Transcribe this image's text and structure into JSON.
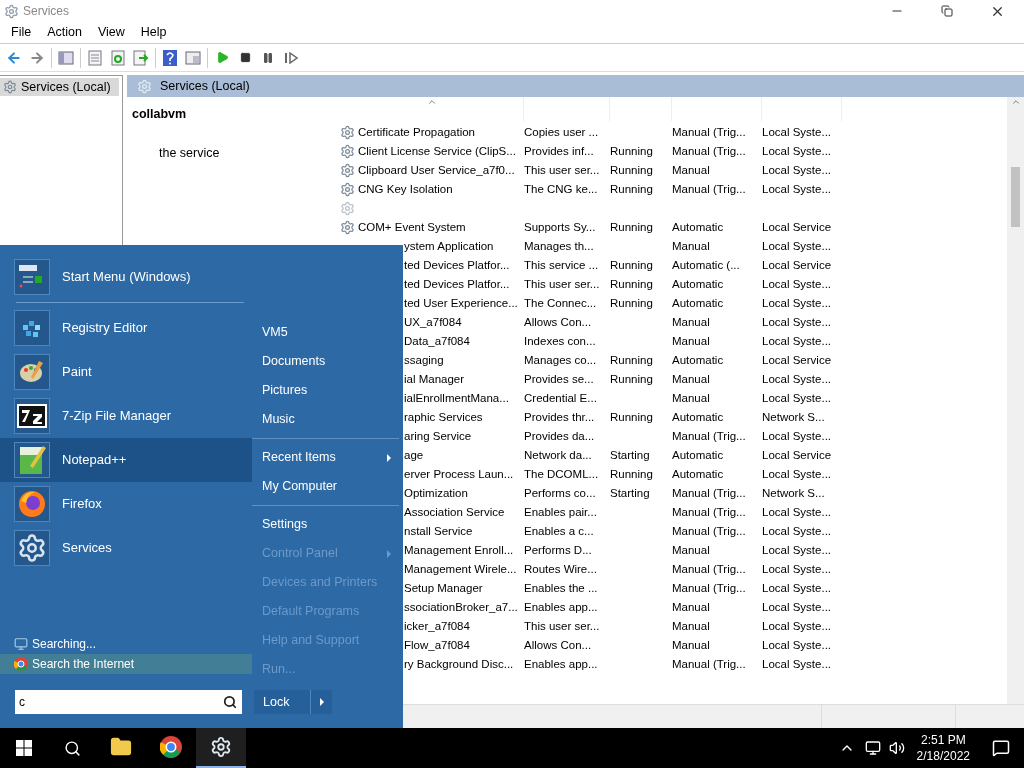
{
  "window": {
    "title": "Services"
  },
  "menu": [
    "File",
    "Action",
    "View",
    "Help"
  ],
  "tree": {
    "label": "Services (Local)",
    "selected": true
  },
  "pane_header": "Services (Local)",
  "description": {
    "title": "collabvm",
    "text": "the service"
  },
  "services": [
    {
      "name": "Certificate Propagation",
      "description": "Copies user ...",
      "startup": "Manual (Trig...",
      "logon": "Local Syste...",
      "covered": false
    },
    {
      "name": "Client License Service (ClipS...",
      "description": "Provides inf...",
      "status": "Running",
      "startup": "Manual (Trig...",
      "logon": "Local Syste...",
      "covered": false
    },
    {
      "name": "Clipboard User Service_a7f0...",
      "description": "This user ser...",
      "status": "Running",
      "startup": "Manual",
      "logon": "Local Syste...",
      "covered": false
    },
    {
      "name": "CNG Key Isolation",
      "description": "The CNG ke...",
      "status": "Running",
      "startup": "Manual (Trig...",
      "logon": "Local Syste...",
      "covered": false
    },
    {
      "covered": false
    },
    {
      "name": "COM+ Event System",
      "description": "Supports Sy...",
      "status": "Running",
      "startup": "Automatic",
      "logon": "Local Service",
      "covered": false
    },
    {
      "name": "ystem Application",
      "description": "Manages th...",
      "startup": "Manual",
      "logon": "Local Syste...",
      "covered": true
    },
    {
      "name": "ted Devices Platfor...",
      "description": "This service ...",
      "status": "Running",
      "startup": "Automatic (...",
      "logon": "Local Service",
      "covered": true
    },
    {
      "name": "ted Devices Platfor...",
      "description": "This user ser...",
      "status": "Running",
      "startup": "Automatic",
      "logon": "Local Syste...",
      "covered": true
    },
    {
      "name": "ted User Experience...",
      "description": "The Connec...",
      "status": "Running",
      "startup": "Automatic",
      "logon": "Local Syste...",
      "covered": true
    },
    {
      "name": "UX_a7f084",
      "description": "Allows Con...",
      "startup": "Manual",
      "logon": "Local Syste...",
      "covered": true
    },
    {
      "name": "Data_a7f084",
      "description": "Indexes con...",
      "startup": "Manual",
      "logon": "Local Syste...",
      "covered": true
    },
    {
      "name": "ssaging",
      "description": "Manages co...",
      "status": "Running",
      "startup": "Automatic",
      "logon": "Local Service",
      "covered": true
    },
    {
      "name": "ial Manager",
      "description": "Provides se...",
      "status": "Running",
      "startup": "Manual",
      "logon": "Local Syste...",
      "covered": true
    },
    {
      "name": "ialEnrollmentMana...",
      "description": "Credential E...",
      "startup": "Manual",
      "logon": "Local Syste...",
      "covered": true
    },
    {
      "name": "raphic Services",
      "description": "Provides thr...",
      "status": "Running",
      "startup": "Automatic",
      "logon": "Network S...",
      "covered": true
    },
    {
      "name": "aring Service",
      "description": "Provides da...",
      "startup": "Manual (Trig...",
      "logon": "Local Syste...",
      "covered": true
    },
    {
      "name": "age",
      "description": "Network da...",
      "status": "Starting",
      "startup": "Automatic",
      "logon": "Local Service",
      "covered": true
    },
    {
      "name": "erver Process Laun...",
      "description": "The DCOML...",
      "status": "Running",
      "startup": "Automatic",
      "logon": "Local Syste...",
      "covered": true
    },
    {
      "name": "Optimization",
      "description": "Performs co...",
      "status": "Starting",
      "startup": "Manual (Trig...",
      "logon": "Network S...",
      "covered": true
    },
    {
      "name": "Association Service",
      "description": "Enables pair...",
      "startup": "Manual (Trig...",
      "logon": "Local Syste...",
      "covered": true
    },
    {
      "name": "nstall Service",
      "description": "Enables a c...",
      "startup": "Manual (Trig...",
      "logon": "Local Syste...",
      "covered": true
    },
    {
      "name": "Management Enroll...",
      "description": "Performs D...",
      "startup": "Manual",
      "logon": "Local Syste...",
      "covered": true
    },
    {
      "name": "Management Wirele...",
      "description": "Routes Wire...",
      "startup": "Manual (Trig...",
      "logon": "Local Syste...",
      "covered": true
    },
    {
      "name": "Setup Manager",
      "description": "Enables the ...",
      "startup": "Manual (Trig...",
      "logon": "Local Syste...",
      "covered": true
    },
    {
      "name": "ssociationBroker_a7...",
      "description": "Enables app...",
      "startup": "Manual",
      "logon": "Local Syste...",
      "covered": true
    },
    {
      "name": "icker_a7f084",
      "description": "This user ser...",
      "startup": "Manual",
      "logon": "Local Syste...",
      "covered": true
    },
    {
      "name": "Flow_a7f084",
      "description": "Allows Con...",
      "startup": "Manual",
      "logon": "Local Syste...",
      "covered": true
    },
    {
      "name": "ry Background Disc...",
      "description": "Enables app...",
      "startup": "Manual (Trig...",
      "logon": "Local Syste...",
      "covered": true
    }
  ],
  "start_menu": {
    "pinned": [
      {
        "label": "Start Menu (Windows)",
        "selected": false
      }
    ],
    "programs": [
      {
        "label": "Registry Editor",
        "selected": false
      },
      {
        "label": "Paint",
        "selected": false
      },
      {
        "label": "7-Zip File Manager",
        "selected": false
      },
      {
        "label": "Notepad++",
        "selected": true
      },
      {
        "label": "Firefox",
        "selected": false
      },
      {
        "label": "Services",
        "selected": false
      }
    ],
    "search_results": [
      {
        "label": "Searching...",
        "selected": false
      },
      {
        "label": "Search the Internet",
        "selected": true
      }
    ],
    "search": {
      "value": "c"
    },
    "places": [
      [
        {
          "label": "VM5",
          "submenu": false,
          "disabled": false
        },
        {
          "label": "Documents",
          "submenu": false,
          "disabled": false
        },
        {
          "label": "Pictures",
          "submenu": false,
          "disabled": false
        },
        {
          "label": "Music",
          "submenu": false,
          "disabled": false
        }
      ],
      [
        {
          "label": "Recent Items",
          "submenu": true,
          "disabled": false
        },
        {
          "label": "My Computer",
          "submenu": false,
          "disabled": false
        }
      ],
      [
        {
          "label": "Settings",
          "submenu": false,
          "disabled": false
        },
        {
          "label": "Control Panel",
          "submenu": true,
          "disabled": true
        },
        {
          "label": "Devices and Printers",
          "submenu": false,
          "disabled": true
        },
        {
          "label": "Default Programs",
          "submenu": false,
          "disabled": true
        },
        {
          "label": "Help and Support",
          "submenu": false,
          "disabled": true
        },
        {
          "label": "Run...",
          "submenu": false,
          "disabled": true
        }
      ]
    ],
    "power": "Lock"
  },
  "taskbar": {
    "apps": [
      {
        "kind": "explorer",
        "selected": false
      },
      {
        "kind": "chrome",
        "selected": false
      },
      {
        "kind": "services",
        "selected": true
      }
    ],
    "time": "2:51 PM",
    "date": "2/18/2022"
  }
}
